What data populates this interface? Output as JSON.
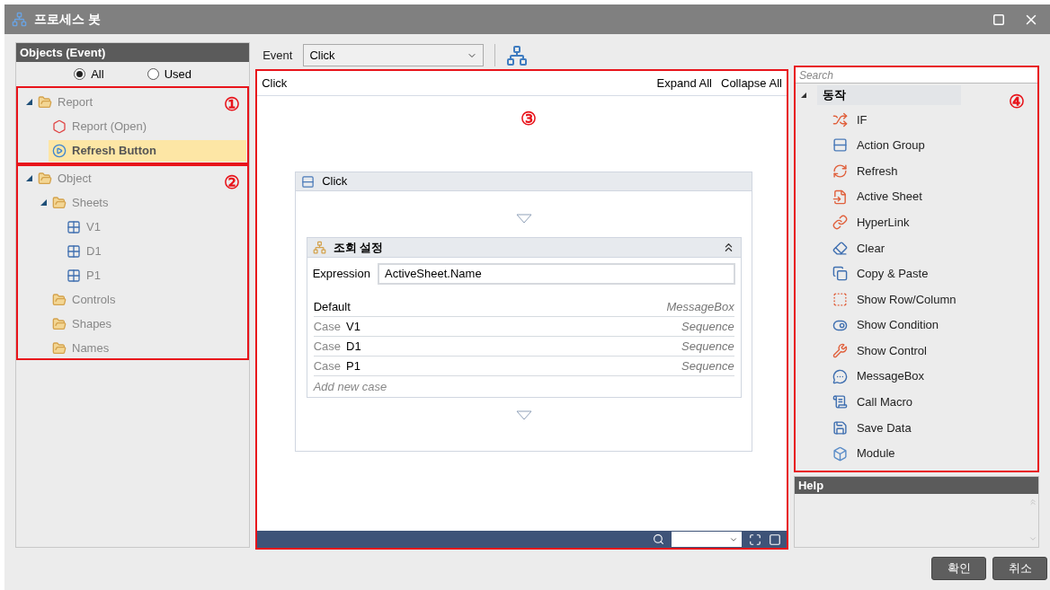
{
  "window": {
    "title": "프로세스 봇"
  },
  "objects_panel": {
    "title": "Objects (Event)",
    "filter": [
      {
        "label": "All",
        "selected": true
      },
      {
        "label": "Used",
        "selected": false
      }
    ],
    "groups": [
      {
        "annotation": "①",
        "items": [
          {
            "label": "Report",
            "kind": "folder",
            "selected": false,
            "children": [
              {
                "label": "Report (Open)",
                "kind": "report",
                "selected": false
              },
              {
                "label": "Refresh Button",
                "kind": "button",
                "selected": true
              }
            ]
          }
        ]
      },
      {
        "annotation": "②",
        "items": [
          {
            "label": "Object",
            "kind": "folder",
            "selected": false,
            "children": [
              {
                "label": "Sheets",
                "kind": "folder",
                "selected": false,
                "children": [
                  {
                    "label": "V1",
                    "kind": "sheet",
                    "selected": false
                  },
                  {
                    "label": "D1",
                    "kind": "sheet",
                    "selected": false
                  },
                  {
                    "label": "P1",
                    "kind": "sheet",
                    "selected": false
                  }
                ]
              },
              {
                "label": "Controls",
                "kind": "folder",
                "selected": false
              },
              {
                "label": "Shapes",
                "kind": "folder",
                "selected": false
              },
              {
                "label": "Names",
                "kind": "folder",
                "selected": false
              }
            ]
          }
        ]
      }
    ]
  },
  "event_bar": {
    "label": "Event",
    "value": "Click"
  },
  "canvas": {
    "annotation": "③",
    "title": "Click",
    "actions": [
      "Expand All",
      "Collapse All"
    ],
    "flow": {
      "title": "Click",
      "switch": {
        "title": "조회 설정",
        "expression_label": "Expression",
        "expression": "ActiveSheet.Name",
        "default": {
          "label": "Default",
          "action": "MessageBox"
        },
        "cases": [
          {
            "prefix": "Case",
            "value": "V1",
            "action": "Sequence"
          },
          {
            "prefix": "Case",
            "value": "D1",
            "action": "Sequence"
          },
          {
            "prefix": "Case",
            "value": "P1",
            "action": "Sequence"
          }
        ],
        "add_case": "Add new case"
      }
    }
  },
  "toolbox": {
    "annotation": "④",
    "search_placeholder": "Search",
    "category": "동작",
    "items": [
      {
        "label": "IF",
        "kind": "if"
      },
      {
        "label": "Action Group",
        "kind": "group"
      },
      {
        "label": "Refresh",
        "kind": "refresh"
      },
      {
        "label": "Active Sheet",
        "kind": "sheet"
      },
      {
        "label": "HyperLink",
        "kind": "link"
      },
      {
        "label": "Clear",
        "kind": "clear"
      },
      {
        "label": "Copy & Paste",
        "kind": "copy"
      },
      {
        "label": "Show Row/Column",
        "kind": "rowcol"
      },
      {
        "label": "Show Condition",
        "kind": "condition"
      },
      {
        "label": "Show Control",
        "kind": "control"
      },
      {
        "label": "MessageBox",
        "kind": "message"
      },
      {
        "label": "Call Macro",
        "kind": "macro"
      },
      {
        "label": "Save Data",
        "kind": "save"
      },
      {
        "label": "Module",
        "kind": "module"
      }
    ]
  },
  "help": {
    "title": "Help"
  },
  "buttons": [
    "확인",
    "취소"
  ]
}
